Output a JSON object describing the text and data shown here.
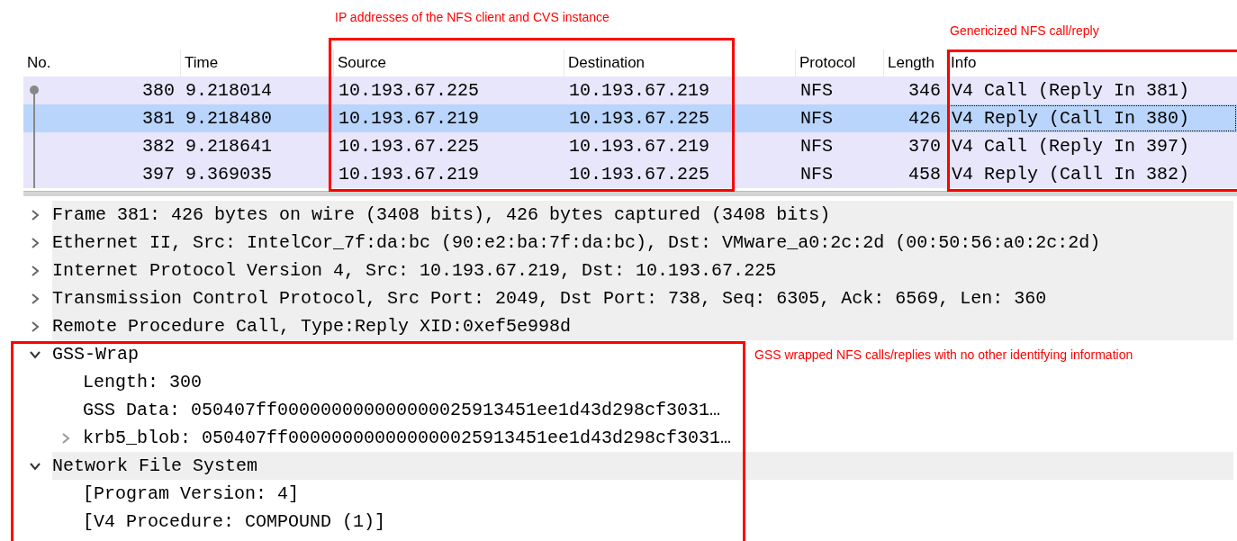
{
  "packet_list": {
    "columns": [
      "No.",
      "Time",
      "Source",
      "Destination",
      "Protocol",
      "Length",
      "Info"
    ],
    "rows": [
      {
        "no": "380",
        "time": "9.218014",
        "source": "10.193.67.225",
        "destination": "10.193.67.219",
        "protocol": "NFS",
        "length": "346",
        "info": "V4 Call (Reply In 381)",
        "selected": false
      },
      {
        "no": "381",
        "time": "9.218480",
        "source": "10.193.67.219",
        "destination": "10.193.67.225",
        "protocol": "NFS",
        "length": "426",
        "info": "V4 Reply (Call In 380)",
        "selected": true
      },
      {
        "no": "382",
        "time": "9.218641",
        "source": "10.193.67.225",
        "destination": "10.193.67.219",
        "protocol": "NFS",
        "length": "370",
        "info": "V4 Call (Reply In 397)",
        "selected": false
      },
      {
        "no": "397",
        "time": "9.369035",
        "source": "10.193.67.219",
        "destination": "10.193.67.225",
        "protocol": "NFS",
        "length": "458",
        "info": "V4 Reply (Call In 382)",
        "selected": false
      }
    ]
  },
  "packet_details": [
    {
      "label": "Frame 381: 426 bytes on wire (3408 bits), 426 bytes captured (3408 bits)",
      "expanded": false,
      "shaded": true
    },
    {
      "label": "Ethernet II, Src: IntelCor_7f:da:bc (90:e2:ba:7f:da:bc), Dst: VMware_a0:2c:2d (00:50:56:a0:2c:2d)",
      "expanded": false,
      "shaded": true
    },
    {
      "label": "Internet Protocol Version 4, Src: 10.193.67.219, Dst: 10.193.67.225",
      "expanded": false,
      "shaded": true
    },
    {
      "label": "Transmission Control Protocol, Src Port: 2049, Dst Port: 738, Seq: 6305, Ack: 6569, Len: 360",
      "expanded": false,
      "shaded": true
    },
    {
      "label": "Remote Procedure Call, Type:Reply XID:0xef5e998d",
      "expanded": false,
      "shaded": true
    },
    {
      "label": "GSS-Wrap",
      "expanded": true,
      "shaded": false,
      "children": [
        {
          "label": "Length: 300",
          "shaded": false
        },
        {
          "label": "GSS Data: 050407ff000000000000000025913451ee1d43d298cf3031…",
          "shaded": false
        },
        {
          "label": "krb5_blob: 050407ff000000000000000025913451ee1d43d298cf3031…",
          "expanded": false,
          "shaded": false
        }
      ]
    },
    {
      "label": "Network File System",
      "expanded": true,
      "shaded": true,
      "children": [
        {
          "label": "[Program Version: 4]",
          "shaded": false
        },
        {
          "label": "[V4 Procedure: COMPOUND (1)]",
          "shaded": false
        }
      ]
    }
  ],
  "annotations": [
    {
      "text": "IP addresses of the NFS client and CVS instance",
      "kind": "ip"
    },
    {
      "text": "Genericized NFS call/reply",
      "kind": "info"
    },
    {
      "text": "GSS wrapped NFS calls/replies with no other identifying information",
      "kind": "gss"
    }
  ]
}
